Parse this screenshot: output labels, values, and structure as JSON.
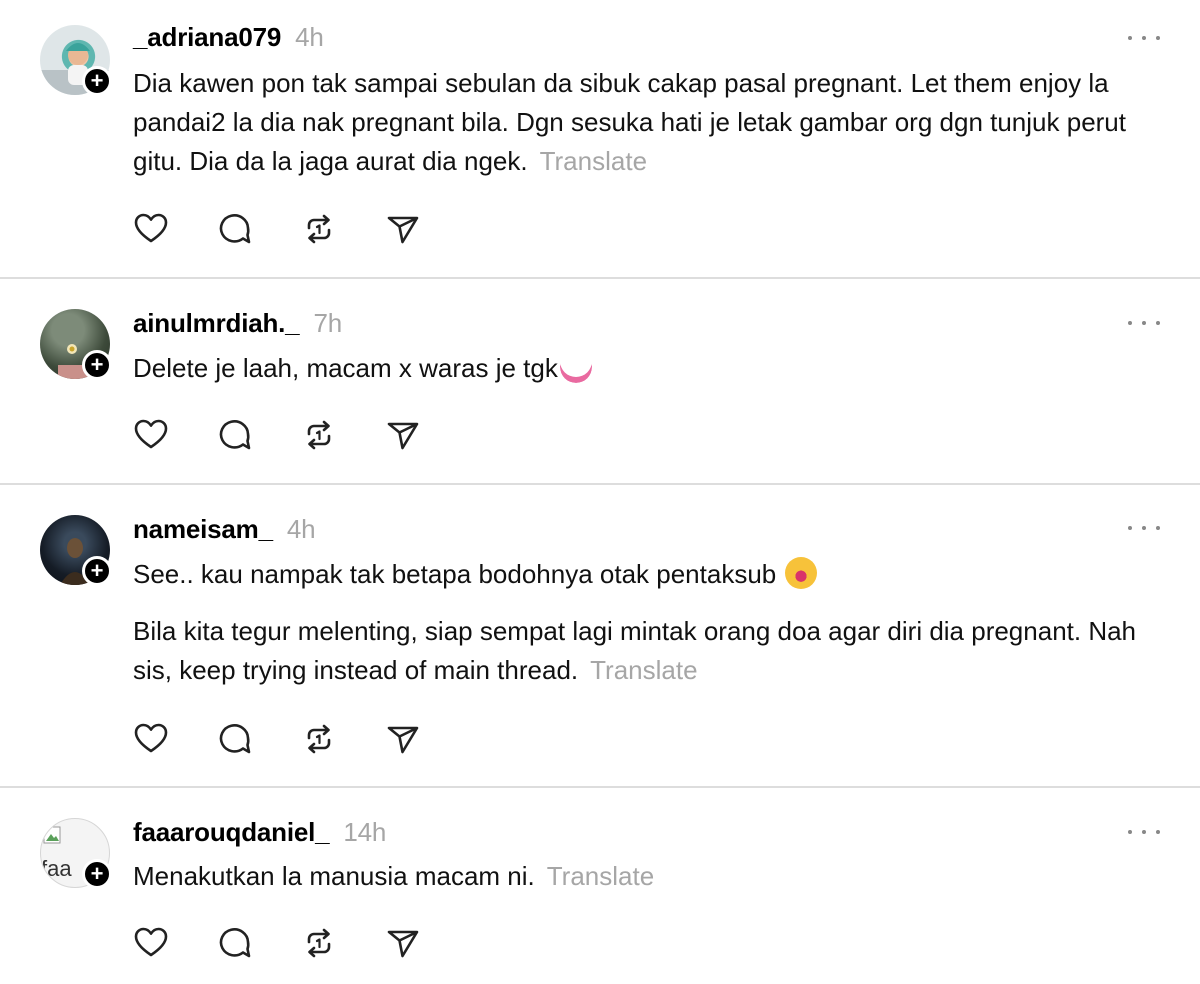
{
  "posts": [
    {
      "username": "_adriana079",
      "time": "4h",
      "paragraphs": [
        "Dia kawen pon tak sampai sebulan da sibuk cakap pasal pregnant. Let them enjoy la pandai2 la dia nak pregnant bila. Dgn sesuka hati je letak gambar org dgn tunjuk perut gitu. Dia da la jaga aurat dia ngek."
      ],
      "translate": "Translate"
    },
    {
      "username": "ainulmrdiah._",
      "time": "7h",
      "paragraphs": [
        "Delete je laah, macam x waras je tgk"
      ],
      "translate": ""
    },
    {
      "username": "nameisam_",
      "time": "4h",
      "paragraphs": [
        "See.. kau nampak tak betapa bodohnya otak pentaksub",
        "Bila kita tegur melenting, siap sempat lagi mintak orang doa agar diri dia pregnant. Nah sis, keep trying instead of main thread."
      ],
      "translate": "Translate"
    },
    {
      "username": "faaarouqdaniel_",
      "time": "14h",
      "paragraphs": [
        "Menakutkan la manusia macam ni."
      ],
      "translate": "Translate",
      "avatar_alt": "faa"
    }
  ],
  "icons": {
    "like": "heart-icon",
    "reply": "comment-icon",
    "repost": "repost-icon",
    "share": "share-icon",
    "more": "more-options-icon",
    "follow": "plus-icon"
  },
  "colors": {
    "muted": "#a6a6a6",
    "divider": "#dddddd",
    "badge": "#000000"
  }
}
